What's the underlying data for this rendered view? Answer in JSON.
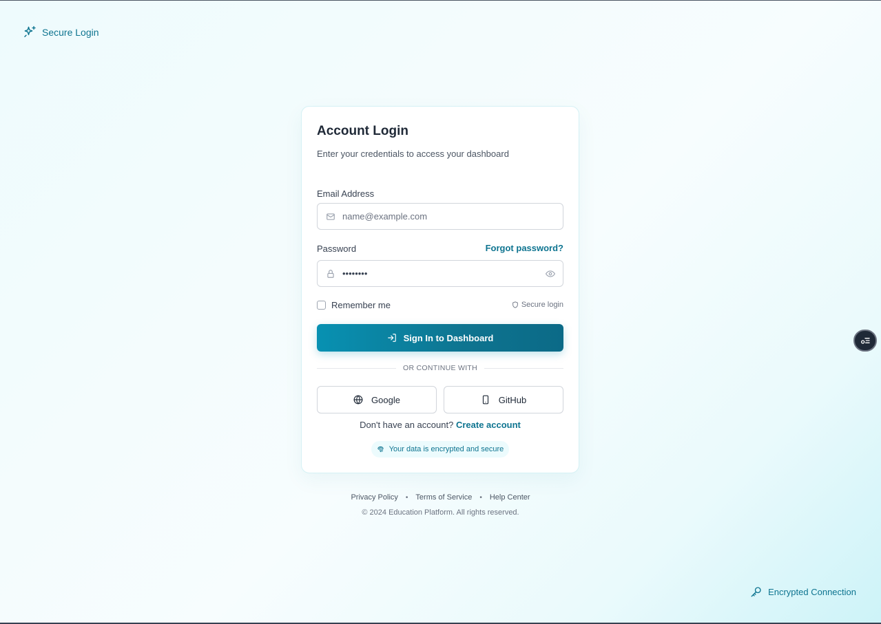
{
  "brand": {
    "label": "Secure Login",
    "icon": "sparkles-icon"
  },
  "card": {
    "title": "Account Login",
    "subtitle": "Enter your credentials to access your dashboard"
  },
  "email": {
    "label": "Email Address",
    "placeholder": "name@example.com",
    "value": "",
    "icon": "mail-icon"
  },
  "password": {
    "label": "Password",
    "value": "••••••••",
    "forgot_label": "Forgot password?",
    "icon": "lock-icon",
    "toggle_icon": "eye-icon"
  },
  "remember": {
    "label": "Remember me",
    "checked": false
  },
  "secure_note": "Secure login",
  "signin": {
    "label": "Sign In to Dashboard",
    "icon": "log-in-icon"
  },
  "divider": "OR CONTINUE WITH",
  "social": {
    "google_label": "Google",
    "github_label": "GitHub"
  },
  "signup": {
    "prompt": "Don't have an account?",
    "link": "Create account"
  },
  "encrypted_note": "Your data is encrypted and secure",
  "footer": {
    "links": [
      "Privacy Policy",
      "Terms of Service",
      "Help Center"
    ],
    "separator": "•",
    "copyright": "© 2024 Education Platform. All rights reserved."
  },
  "corner_badge": "Encrypted Connection",
  "colors": {
    "accent": "#0e7490",
    "accent_light": "#0891b2",
    "background": "#eefbfd"
  }
}
